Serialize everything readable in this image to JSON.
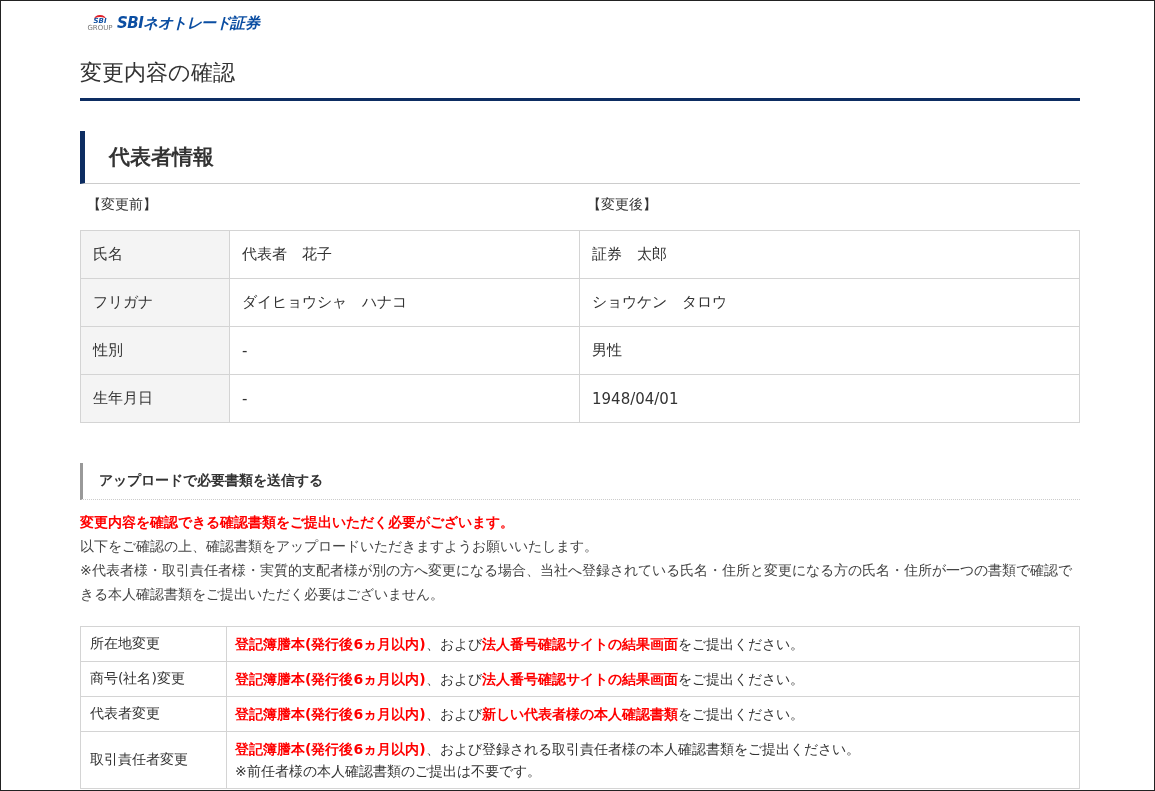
{
  "logo": {
    "mark_text": "SBI",
    "mark_subtext": "GROUP",
    "name": "SBIネオトレード証券"
  },
  "page_title": "変更内容の確認",
  "section": {
    "title": "代表者情報",
    "before_label": "【変更前】",
    "after_label": "【変更後】",
    "rows": [
      {
        "label": "氏名",
        "before": "代表者　花子",
        "after": "証券　太郎"
      },
      {
        "label": "フリガナ",
        "before": "ダイヒョウシャ　ハナコ",
        "after": "ショウケン　タロウ"
      },
      {
        "label": "性別",
        "before": "-",
        "after": "男性"
      },
      {
        "label": "生年月日",
        "before": "-",
        "after": "1948/04/01"
      }
    ]
  },
  "upload": {
    "title": "アップロードで必要書類を送信する",
    "notice": "変更内容を確認できる確認書類をご提出いただく必要がございます。",
    "paragraphs": [
      "以下をご確認の上、確認書類をアップロードいただきますようお願いいたします。",
      "※代表者様・取引責任者様・実質的支配者様が別の方へ変更になる場合、当社へ登録されている氏名・住所と変更になる方の氏名・住所が一つの書類で確認できる本人確認書類をご提出いただく必要はございません。"
    ],
    "requirements": [
      {
        "label": "所在地変更",
        "lines": [
          "**登記簿謄本(発行後6ヵ月以内)**、および**法人番号確認サイトの結果画面**をご提出ください。"
        ]
      },
      {
        "label": "商号(社名)変更",
        "lines": [
          "**登記簿謄本(発行後6ヵ月以内)**、および**法人番号確認サイトの結果画面**をご提出ください。"
        ]
      },
      {
        "label": "代表者変更",
        "lines": [
          "**登記簿謄本(発行後6ヵ月以内)**、および**新しい代表者様の本人確認書類**をご提出ください。"
        ]
      },
      {
        "label": "取引責任者変更",
        "lines": [
          "**登記簿謄本(発行後6ヵ月以内)**、および登録される取引責任者様の本人確認書類をご提出ください。",
          "※前任者様の本人確認書類のご提出は不要です。"
        ]
      }
    ]
  }
}
